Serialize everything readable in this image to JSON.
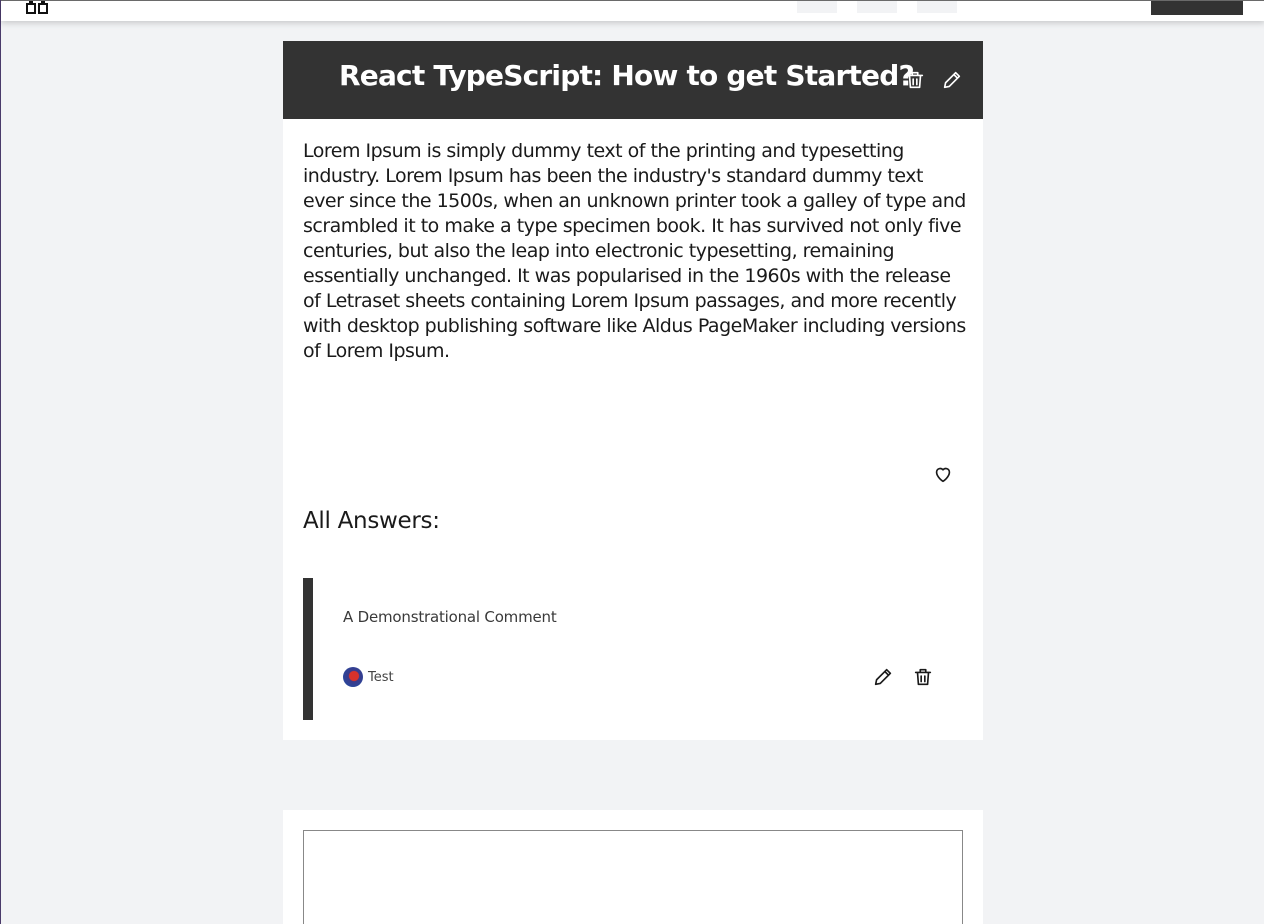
{
  "header": {
    "logo_icon": "binoculars-icon",
    "nav_buttons": 3
  },
  "question": {
    "title": "React TypeScript: How to get Started?",
    "delete_icon": "trash-icon",
    "edit_icon": "pencil-icon",
    "body": "Lorem Ipsum is simply dummy text of the printing and typesetting industry. Lorem Ipsum has been the industry's standard dummy text ever since the 1500s, when an unknown printer took a galley of type and scrambled it to make a type specimen book. It has survived not only five centuries, but also the leap into electronic typesetting, remaining essentially unchanged. It was popularised in the 1960s with the release of Letraset sheets containing Lorem Ipsum passages, and more recently with desktop publishing software like Aldus PageMaker including versions of Lorem Ipsum.",
    "like_icon": "heart-icon"
  },
  "answers": {
    "heading": "All Answers:",
    "items": [
      {
        "text": "A Demonstrational Comment",
        "author": "Test",
        "edit_icon": "pencil-icon",
        "delete_icon": "trash-icon"
      }
    ]
  },
  "new_answer": {
    "value": "",
    "placeholder": ""
  },
  "colors": {
    "dark": "#333333",
    "background": "#f2f3f5",
    "card": "#ffffff"
  }
}
